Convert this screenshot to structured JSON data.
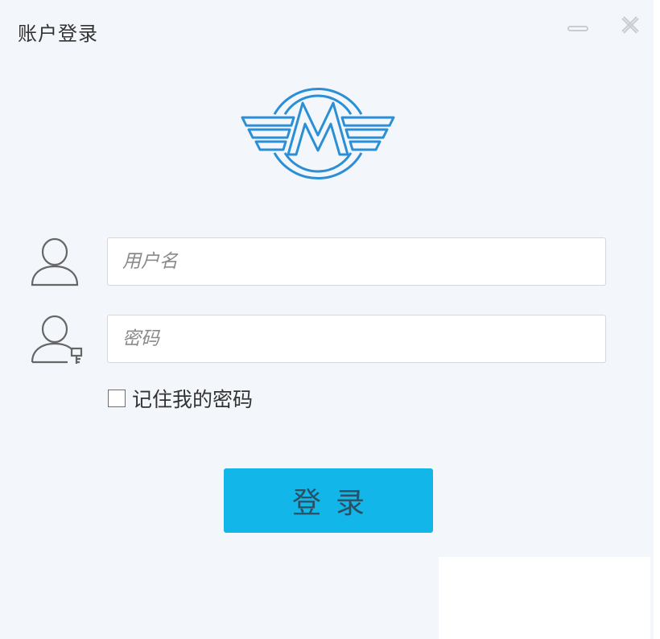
{
  "window": {
    "title": "账户登录",
    "controls": {
      "minimize_icon": "minimize-icon",
      "close_icon": "close-icon"
    }
  },
  "logo": {
    "icon": "metro-wings-logo",
    "letter": "M",
    "color": "#2a8fd5"
  },
  "form": {
    "username": {
      "icon": "user-icon",
      "placeholder": "用户名",
      "value": ""
    },
    "password": {
      "icon": "user-key-icon",
      "placeholder": "密码",
      "value": ""
    },
    "remember": {
      "label": "记住我的密码",
      "checked": false
    },
    "submit_label": "登录"
  },
  "colors": {
    "background": "#f3f6fa",
    "accent": "#12b6e8",
    "button_text": "#2b5063",
    "icon_stroke": "#666666"
  }
}
